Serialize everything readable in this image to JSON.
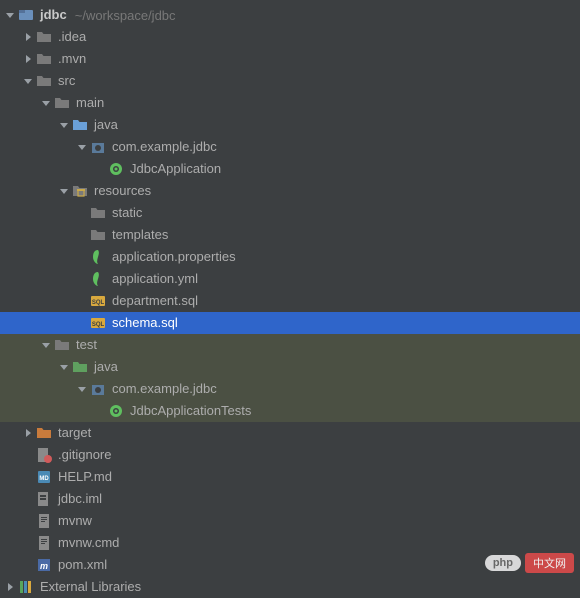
{
  "project": {
    "name": "jdbc",
    "path": "~/workspace/jdbc"
  },
  "tree": [
    {
      "id": "root",
      "indent": 0,
      "arrow": "down",
      "icon": "module",
      "label": "jdbc",
      "bold": true,
      "suffix": "~/workspace/jdbc"
    },
    {
      "id": "idea",
      "indent": 1,
      "arrow": "right",
      "icon": "folder",
      "label": ".idea"
    },
    {
      "id": "mvn",
      "indent": 1,
      "arrow": "right",
      "icon": "folder",
      "label": ".mvn"
    },
    {
      "id": "src",
      "indent": 1,
      "arrow": "down",
      "icon": "folder",
      "label": "src"
    },
    {
      "id": "main",
      "indent": 2,
      "arrow": "down",
      "icon": "folder",
      "label": "main"
    },
    {
      "id": "main-java",
      "indent": 3,
      "arrow": "down",
      "icon": "source-folder",
      "label": "java"
    },
    {
      "id": "pkg-main",
      "indent": 4,
      "arrow": "down",
      "icon": "package",
      "label": "com.example.jdbc"
    },
    {
      "id": "app",
      "indent": 5,
      "arrow": "none",
      "icon": "spring-class",
      "label": "JdbcApplication"
    },
    {
      "id": "resources",
      "indent": 3,
      "arrow": "down",
      "icon": "resources-folder",
      "label": "resources"
    },
    {
      "id": "static",
      "indent": 4,
      "arrow": "none",
      "icon": "folder",
      "label": "static"
    },
    {
      "id": "templates",
      "indent": 4,
      "arrow": "none",
      "icon": "folder",
      "label": "templates"
    },
    {
      "id": "app-props",
      "indent": 4,
      "arrow": "none",
      "icon": "spring-config",
      "label": "application.properties"
    },
    {
      "id": "app-yml",
      "indent": 4,
      "arrow": "none",
      "icon": "spring-config",
      "label": "application.yml"
    },
    {
      "id": "dept-sql",
      "indent": 4,
      "arrow": "none",
      "icon": "sql",
      "label": "department.sql"
    },
    {
      "id": "schema-sql",
      "indent": 4,
      "arrow": "none",
      "icon": "sql",
      "label": "schema.sql",
      "selected": true
    },
    {
      "id": "test",
      "indent": 2,
      "arrow": "down",
      "icon": "folder",
      "label": "test",
      "highlighted": true
    },
    {
      "id": "test-java",
      "indent": 3,
      "arrow": "down",
      "icon": "test-folder",
      "label": "java",
      "highlighted": true
    },
    {
      "id": "pkg-test",
      "indent": 4,
      "arrow": "down",
      "icon": "package",
      "label": "com.example.jdbc",
      "highlighted": true
    },
    {
      "id": "tests",
      "indent": 5,
      "arrow": "none",
      "icon": "spring-class",
      "label": "JdbcApplicationTests",
      "highlighted": true
    },
    {
      "id": "target",
      "indent": 1,
      "arrow": "right",
      "icon": "excluded-folder",
      "label": "target"
    },
    {
      "id": "gitignore",
      "indent": 1,
      "arrow": "none",
      "icon": "gitignore",
      "label": ".gitignore"
    },
    {
      "id": "help",
      "indent": 1,
      "arrow": "none",
      "icon": "md",
      "label": "HELP.md"
    },
    {
      "id": "iml",
      "indent": 1,
      "arrow": "none",
      "icon": "iml",
      "label": "jdbc.iml"
    },
    {
      "id": "mvnw",
      "indent": 1,
      "arrow": "none",
      "icon": "file",
      "label": "mvnw"
    },
    {
      "id": "mvnw-cmd",
      "indent": 1,
      "arrow": "none",
      "icon": "file",
      "label": "mvnw.cmd"
    },
    {
      "id": "pom",
      "indent": 1,
      "arrow": "none",
      "icon": "maven",
      "label": "pom.xml"
    },
    {
      "id": "ext-lib",
      "indent": 0,
      "arrow": "right",
      "icon": "libraries",
      "label": "External Libraries"
    }
  ],
  "watermark": {
    "brand": "php",
    "text": "中文网"
  }
}
